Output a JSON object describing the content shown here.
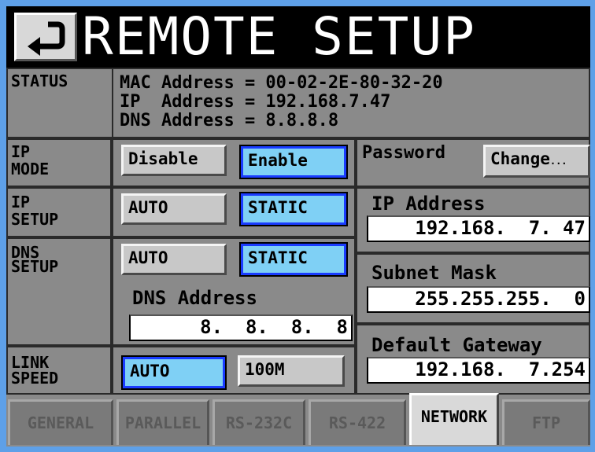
{
  "title": "REMOTE SETUP",
  "status": {
    "label": "STATUS",
    "lines": [
      "MAC Address = 00-02-2E-80-32-20",
      "IP  Address = 192.168.7.47",
      "DNS Address = 8.8.8.8"
    ]
  },
  "ip_mode": {
    "label_line1": "IP",
    "label_line2": "MODE",
    "disable": "Disable",
    "enable": "Enable",
    "selected": "enable"
  },
  "password": {
    "label": "Password",
    "change": "Change"
  },
  "ip_setup": {
    "label_line1": "IP",
    "label_line2": "SETUP",
    "auto": "AUTO",
    "static": "STATIC",
    "selected": "static"
  },
  "dns_setup": {
    "label_line1": "DNS",
    "label_line2": "SETUP",
    "auto": "AUTO",
    "static": "STATIC",
    "selected": "static",
    "address_label": "DNS Address",
    "address_value": "8.  8.  8.  8"
  },
  "link_speed": {
    "label_line1": "LINK",
    "label_line2": "SPEED",
    "auto": "AUTO",
    "m100": "100M",
    "selected": "auto"
  },
  "network": {
    "ip_label": "IP Address",
    "ip_value": "192.168.  7. 47",
    "subnet_label": "Subnet Mask",
    "subnet_value": "255.255.255.  0",
    "gateway_label": "Default Gateway",
    "gateway_value": "192.168.  7.254"
  },
  "tabs": [
    "GENERAL",
    "PARALLEL",
    "RS-232C",
    "RS-422",
    "NETWORK",
    "FTP"
  ],
  "active_tab": "NETWORK",
  "colors": {
    "active_button": "#7fd0f5",
    "active_border": "#1a3cff",
    "panel": "#8a8a8a",
    "frame": "#5ea0e8"
  }
}
